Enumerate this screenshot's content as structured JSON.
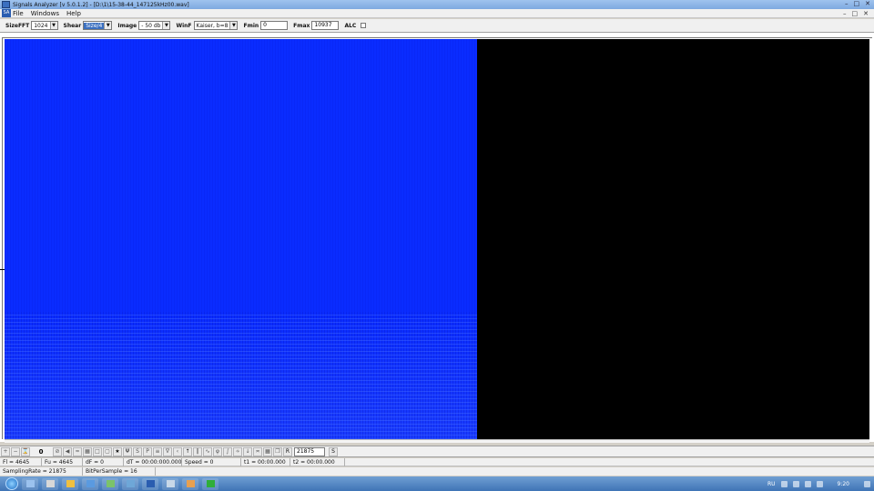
{
  "window": {
    "title": "Signals Analyzer [v 5.0.1.2] - [D:\\1\\15-38-44_147125kHz00.wav]"
  },
  "menu": {
    "items": [
      "File",
      "Windows",
      "Help"
    ]
  },
  "toolbar": {
    "sizefft_label": "SizeFFT",
    "sizefft_value": "1024",
    "shear_label": "Shear",
    "shear_value": "Size/4",
    "image_label": "Image",
    "image_value": "- 50 db",
    "winf_label": "WinF",
    "winf_value": "Kaiser, b=8",
    "fmin_label": "Fmin",
    "fmin_value": "0",
    "fmax_label": "Fmax",
    "fmax_value": "10937",
    "alc_label": "ALC"
  },
  "bottom_bar": {
    "counter": "0",
    "r_label": "R",
    "r_value": "21875",
    "s_label": "S"
  },
  "status": {
    "fl": "Fl = 4645",
    "fu": "Fu = 4645",
    "df": "dF = 0",
    "dt": "dT = 00:00:000.000",
    "speed": "Speed = 0",
    "t1": "t1 = 00:00.000",
    "t2": "t2 = 00:00.000",
    "sampling_rate": "SamplingRate = 21875",
    "bits": "BitPerSample = 16"
  },
  "taskbar": {
    "lang": "RU",
    "time": "9:20"
  },
  "colors": {
    "spectrogram": "#0a2cff",
    "background": "#000000",
    "taskbar": "#3f74b6"
  }
}
